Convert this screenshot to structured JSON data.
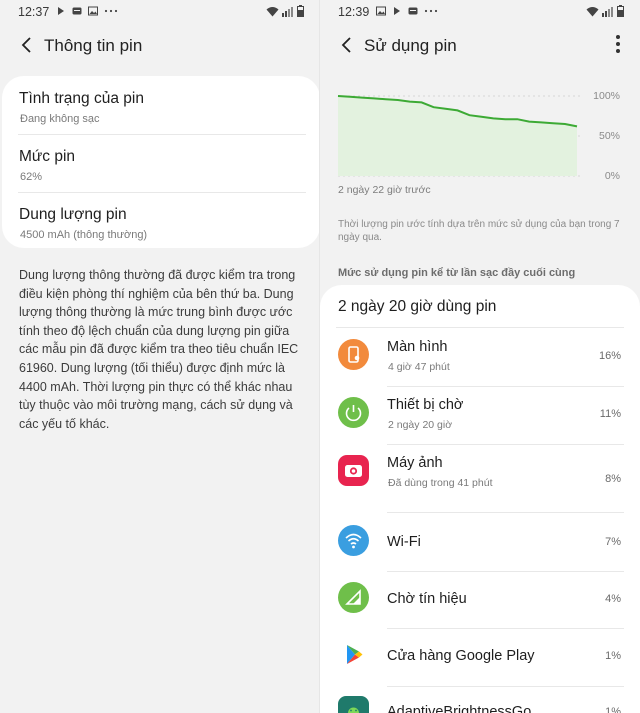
{
  "left": {
    "status": {
      "time": "12:37"
    },
    "title": "Thông tin pin",
    "items": [
      {
        "title": "Tình trạng của pin",
        "subtitle": "Đang không sạc"
      },
      {
        "title": "Mức pin",
        "subtitle": "62%"
      },
      {
        "title": "Dung lượng pin",
        "subtitle": "4500 mAh (thông thường)"
      }
    ],
    "description": "Dung lượng thông thường đã được kiểm tra trong điều kiện phòng thí nghiệm của bên thứ ba. Dung lượng thông thường là mức trung bình được ước tính theo độ lệch chuẩn của dung lượng pin giữa các mẫu pin đã được kiểm tra theo tiêu chuẩn IEC 61960. Dung lượng (tối thiểu) được định mức là 4400 mAh. Thời lượng pin thực có thể khác nhau tùy thuộc vào môi trường mạng, cách sử dụng và các yếu tố khác."
  },
  "right": {
    "status": {
      "time": "12:39"
    },
    "title": "Sử dụng pin",
    "chart": {
      "y_labels": [
        "100%",
        "50%",
        "0%"
      ],
      "caption": "2 ngày 22 giờ trước",
      "note": "Thời lượng pin ước tính dựa trên mức sử dụng của bạn trong 7 ngày qua.",
      "line_color": "#3daa35",
      "fill_color": "#e3f2df"
    },
    "section_header": "Mức sử dụng pin kể từ lần sạc đầy cuối cùng",
    "usage_title": "2 ngày 20 giờ dùng pin",
    "apps": [
      {
        "name": "Màn hình",
        "detail": "4 giờ 47 phút",
        "percent": "16%",
        "icon": "screen-icon",
        "color": "#f28a3c"
      },
      {
        "name": "Thiết bị chờ",
        "detail": "2 ngày 20 giờ",
        "percent": "11%",
        "icon": "power-icon",
        "color": "#6fbf4a"
      },
      {
        "name": "Máy ảnh",
        "detail": "Đã dùng trong 41 phút",
        "percent": "8%",
        "icon": "camera-icon",
        "color": "#e8244f"
      },
      {
        "name": "Wi-Fi",
        "detail": "",
        "percent": "7%",
        "icon": "wifi-icon",
        "color": "#3a9ee0"
      },
      {
        "name": "Chờ tín hiệu",
        "detail": "",
        "percent": "4%",
        "icon": "signal-icon",
        "color": "#6fbf4a"
      },
      {
        "name": "Cửa hàng Google Play",
        "detail": "",
        "percent": "1%",
        "icon": "play-store-icon",
        "color": "#ffffff"
      },
      {
        "name": "AdaptiveBrightnessGo",
        "detail": "",
        "percent": "1%",
        "icon": "android-icon",
        "color": "#1f7a6b"
      }
    ]
  },
  "chart_data": {
    "type": "line",
    "title": "",
    "xlabel": "",
    "ylabel": "",
    "ylim": [
      0,
      100
    ],
    "x": [
      0,
      5,
      10,
      15,
      20,
      25,
      30,
      35,
      40,
      45,
      50,
      55,
      60,
      65,
      70,
      75,
      80,
      85,
      90,
      95,
      100
    ],
    "series": [
      {
        "values": [
          100,
          99,
          98,
          97,
          96,
          95,
          93,
          92,
          86,
          84,
          82,
          76,
          74,
          72,
          71,
          71,
          68,
          67,
          66,
          65,
          62
        ]
      }
    ]
  }
}
